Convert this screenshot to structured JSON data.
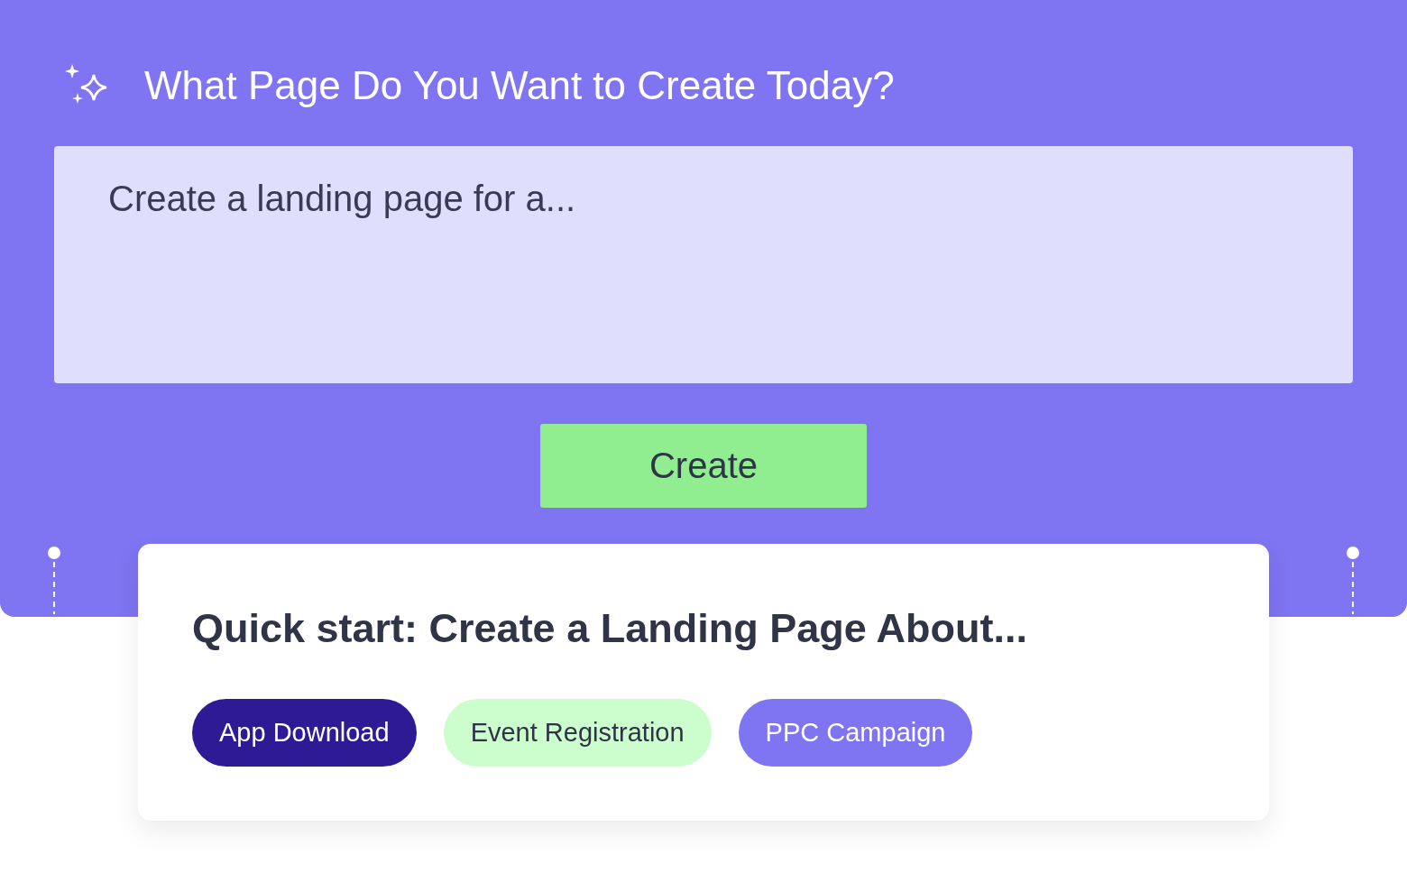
{
  "header": {
    "title": "What Page Do You Want to Create Today?"
  },
  "prompt": {
    "placeholder": "Create a landing page for a..."
  },
  "create_button": {
    "label": "Create"
  },
  "quick_start": {
    "title": "Quick start: Create a Landing Page About...",
    "chips": [
      {
        "label": "App Download",
        "color": "#2f1a96"
      },
      {
        "label": "Event Registration",
        "color": "#ccfdcc"
      },
      {
        "label": "PPC Campaign",
        "color": "#7f74f1"
      }
    ]
  }
}
